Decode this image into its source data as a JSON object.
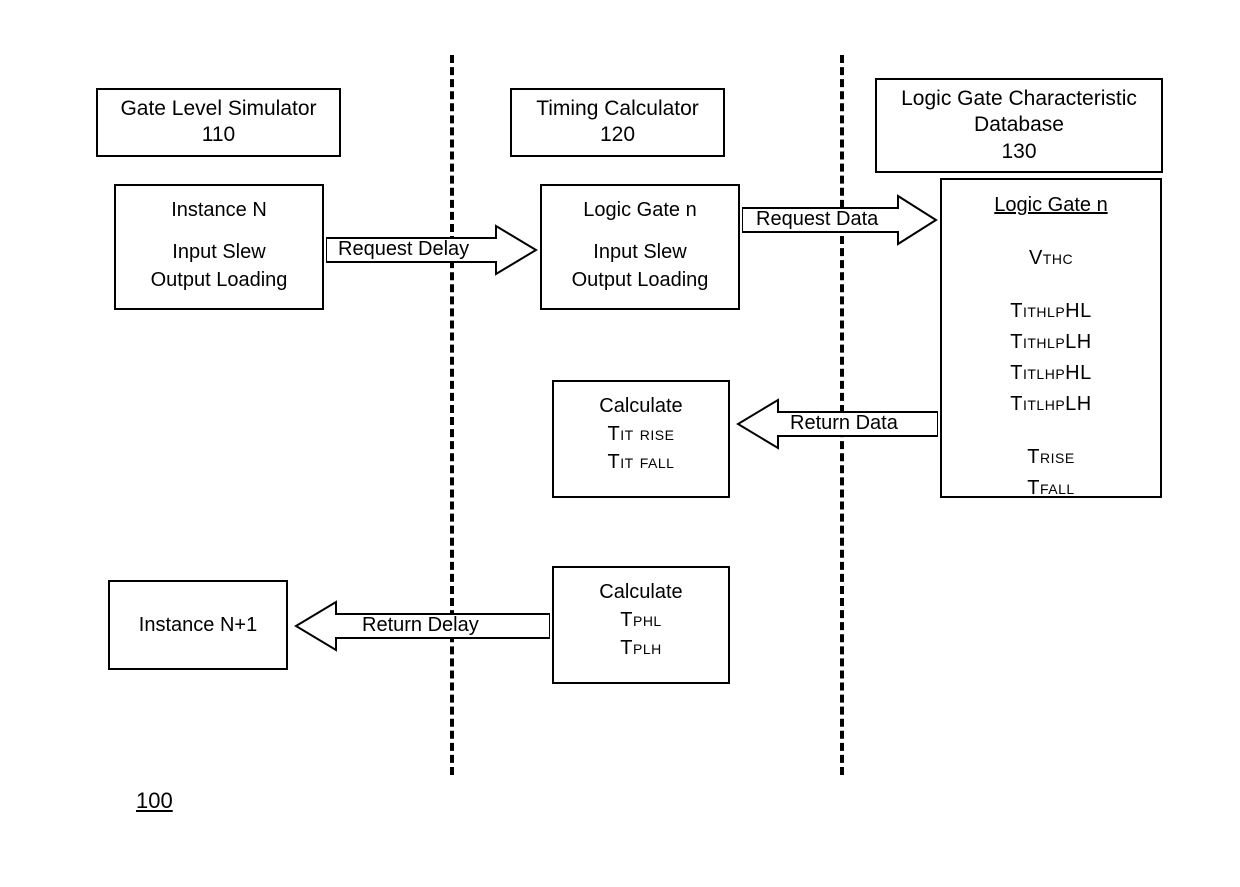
{
  "headers": {
    "sim": {
      "title": "Gate Level Simulator",
      "id": "110"
    },
    "calc": {
      "title": "Timing Calculator",
      "id": "120"
    },
    "db": {
      "title": "Logic Gate Characteristic Database",
      "id": "130"
    }
  },
  "nodes": {
    "instance_n": {
      "title": "Instance N",
      "l1": "Input Slew",
      "l2": "Output Loading"
    },
    "logic_gate_n": {
      "title": "Logic Gate n",
      "l1": "Input Slew",
      "l2": "Output Loading"
    },
    "calc_tit": {
      "title": "Calculate",
      "l1": "Tit rise",
      "l2": "Tit fall"
    },
    "calc_tp": {
      "title": "Calculate",
      "l1": "Tphl",
      "l2": "Tplh"
    },
    "instance_n1": {
      "title": "Instance N+1"
    },
    "db_detail": {
      "title": "Logic Gate n",
      "v": "Vthc",
      "t1": "TithlpHL",
      "t2": "TithlpLH",
      "t3": "TitlhpHL",
      "t4": "TitlhpLH",
      "tr": "Trise",
      "tf": "Tfall"
    }
  },
  "arrows": {
    "request_delay": "Request Delay",
    "request_data": "Request Data",
    "return_data": "Return Data",
    "return_delay": "Return Delay"
  },
  "figref": "100"
}
